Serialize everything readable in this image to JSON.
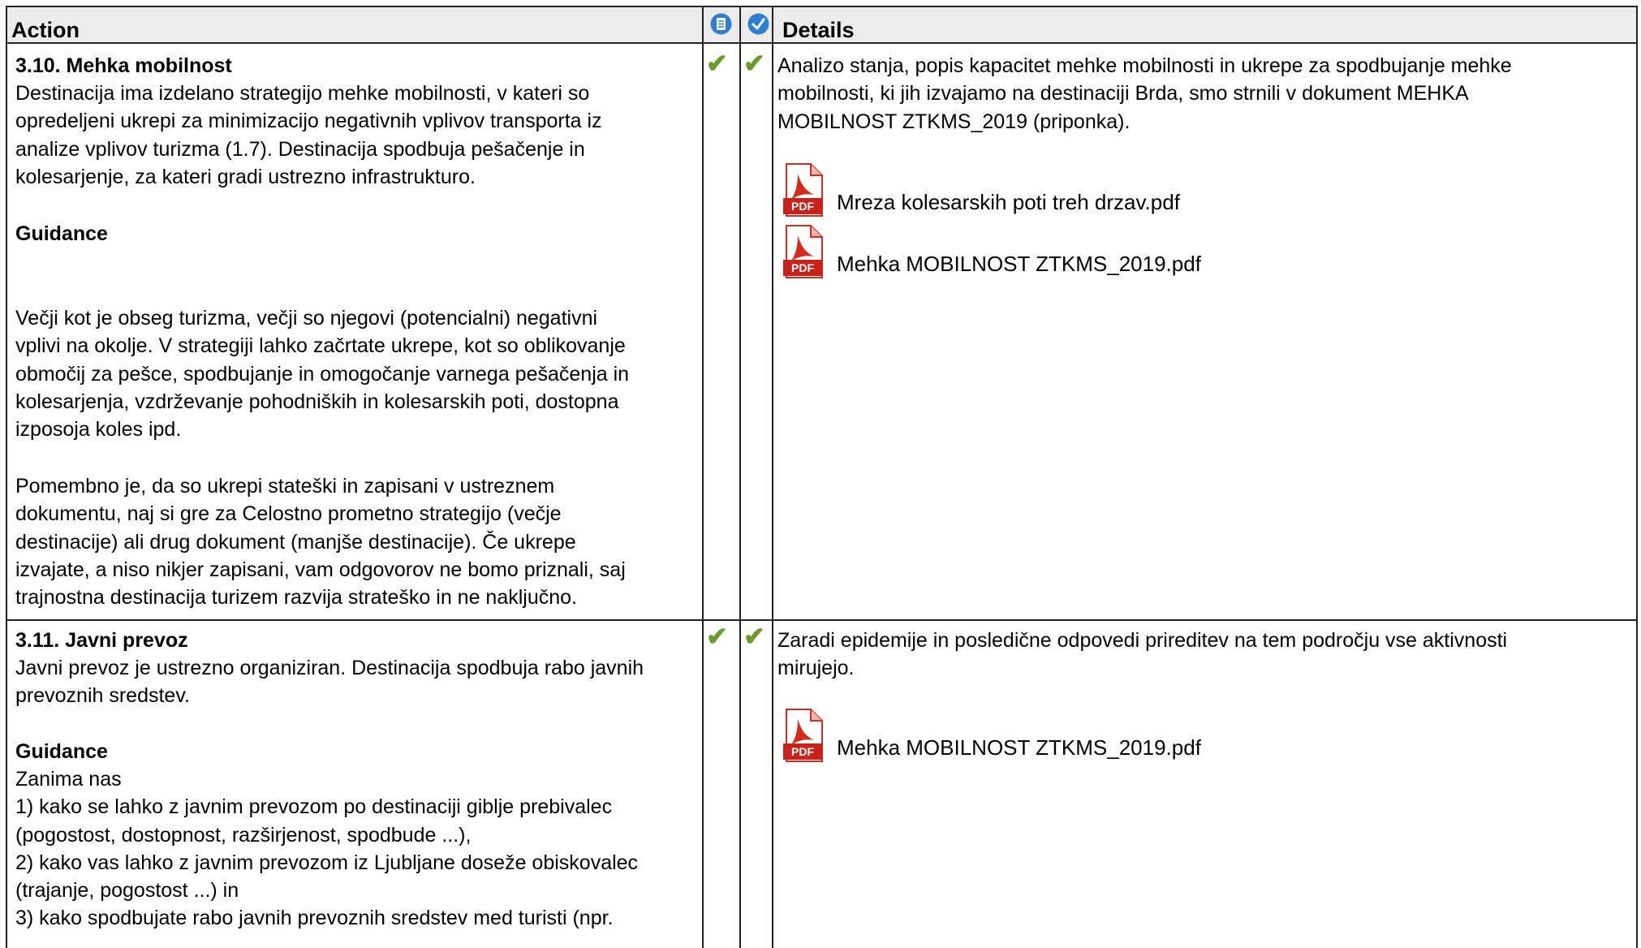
{
  "header": {
    "action": "Action",
    "details": "Details",
    "icon_guidance": "guidance-icon",
    "icon_check": "check-circle-icon"
  },
  "colors": {
    "header_bg": "#ececec",
    "check_green": "#6a9a2a",
    "icon_blue": "#2f7fd0",
    "pdf_red": "#d62a1e"
  },
  "rows": [
    {
      "title": "3.10. Mehka mobilnost",
      "description": "Destinacija ima izdelano strategijo mehke mobilnosti, v kateri so\nopredeljeni ukrepi za minimizacijo negativnih vplivov transporta iz\nanalize vplivov turizma (1.7). Destinacija spodbuja pešačenje in\nkolesarjenje, za kateri gradi ustrezno infrastrukturo.",
      "guidance_label": "Guidance",
      "guidance_text_1": "Večji kot je obseg turizma, večji so njegovi (potencialni) negativni\nvplivi na okolje. V strategiji lahko začrtate ukrepe, kot so oblikovanje\nobmočij za pešce, spodbujanje in omogočanje varnega pešačenja in\nkolesarjenja, vzdrževanje pohodniških in kolesarskih poti, dostopna\nizposoja koles ipd.",
      "guidance_text_2": "Pomembno je, da so ukrepi stateški in zapisani v ustreznem\ndokumentu, naj si gre za Celostno prometno strategijo (večje\ndestinacije) ali drug dokument (manjše destinacije). Če ukrepe\nizvajate, a niso nikjer zapisani, vam odgovorov ne bomo priznali, saj\ntrajnostna destinacija turizem razvija strateško in ne naključno.",
      "check1": "✔",
      "check2": "✔",
      "details": "Analizo stanja, popis kapacitet mehke mobilnosti in ukrepe za spodbujanje mehke\nmobilnosti, ki jih izvajamo na destinaciji Brda, smo strnili v dokument MEHKA\nMOBILNOST ZTKMS_2019 (priponka).",
      "attachments": [
        {
          "name": "Mreza kolesarskih poti treh drzav.pdf",
          "icon": "pdf-icon",
          "badge": "PDF"
        },
        {
          "name": "Mehka MOBILNOST ZTKMS_2019.pdf",
          "icon": "pdf-icon",
          "badge": "PDF"
        }
      ]
    },
    {
      "title": "3.11. Javni prevoz",
      "description": "Javni prevoz je ustrezno organiziran. Destinacija spodbuja rabo javnih\nprevoznih sredstev.",
      "guidance_label": "Guidance",
      "guidance_text_1": "Zanima nas\n1) kako se lahko z javnim prevozom po destinaciji giblje prebivalec\n(pogostost, dostopnost, razširjenost, spodbude ...),\n2) kako vas lahko z javnim prevozom iz Ljubljane doseže obiskovalec\n(trajanje, pogostost ...) in\n3) kako spodbujate rabo javnih prevoznih sredstev med turisti (npr.",
      "check1": "✔",
      "check2": "✔",
      "details": "Zaradi epidemije in posledične odpovedi prireditev na tem področju vse aktivnosti\nmirujejo.",
      "attachments": [
        {
          "name": "Mehka MOBILNOST ZTKMS_2019.pdf",
          "icon": "pdf-icon",
          "badge": "PDF"
        }
      ]
    }
  ]
}
